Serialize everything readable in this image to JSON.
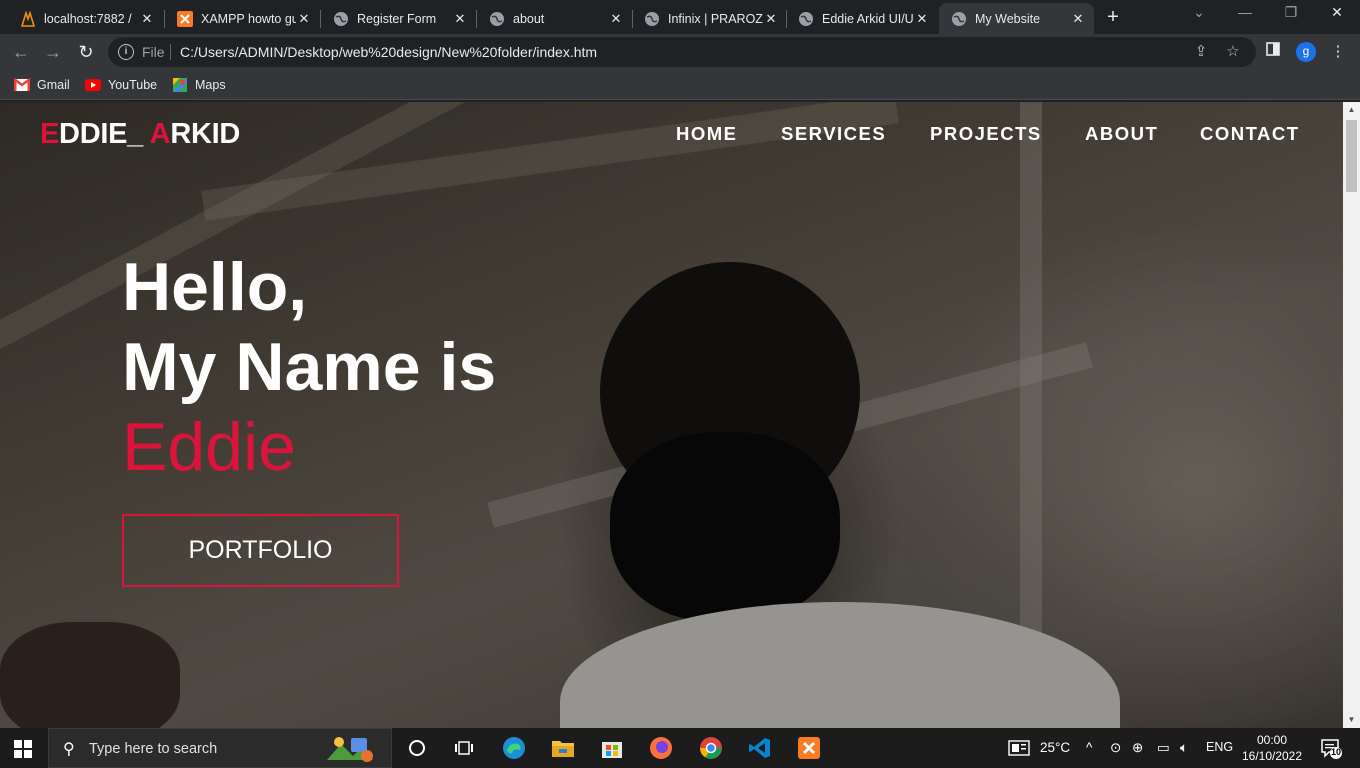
{
  "browser": {
    "tabs": [
      {
        "title": "localhost:7882 / ",
        "icon": "xampp-phpmyadmin-icon",
        "active": false
      },
      {
        "title": "XAMPP howto gu",
        "icon": "xampp-icon",
        "active": false
      },
      {
        "title": "Register Form",
        "icon": "globe-icon",
        "active": false
      },
      {
        "title": "about",
        "icon": "globe-icon",
        "active": false
      },
      {
        "title": "Infinix | PRAROZ",
        "icon": "globe-icon",
        "active": false
      },
      {
        "title": "Eddie Arkid UI/U",
        "icon": "globe-icon",
        "active": false
      },
      {
        "title": "My Website",
        "icon": "globe-icon",
        "active": true
      }
    ],
    "close_glyph": "✕",
    "new_tab_glyph": "+",
    "address": {
      "scheme_label": "File",
      "url": "C:/Users/ADMIN/Desktop/web%20design/New%20folder/index.htm"
    },
    "profile_initial": "g",
    "bookmarks": [
      {
        "label": "Gmail",
        "icon": "gmail-icon"
      },
      {
        "label": "YouTube",
        "icon": "youtube-icon"
      },
      {
        "label": "Maps",
        "icon": "maps-icon"
      }
    ]
  },
  "site": {
    "logo": {
      "first_letter": "E",
      "middle": "DDIE_ ",
      "second_letter": "A",
      "rest": "RKID"
    },
    "nav": [
      "HOME",
      "SERVICES",
      "PROJECTS",
      "ABOUT",
      "CONTACT"
    ],
    "hero": {
      "line1": "Hello,",
      "line2": "My Name is",
      "name": "Eddie",
      "button": "PORTFOLIO"
    },
    "accent_color": "#dc143c"
  },
  "taskbar": {
    "search_placeholder": "Type here to search",
    "weather": "25°C",
    "language": "ENG",
    "time": "00:00",
    "date": "16/10/2022",
    "notification_count": "10"
  }
}
